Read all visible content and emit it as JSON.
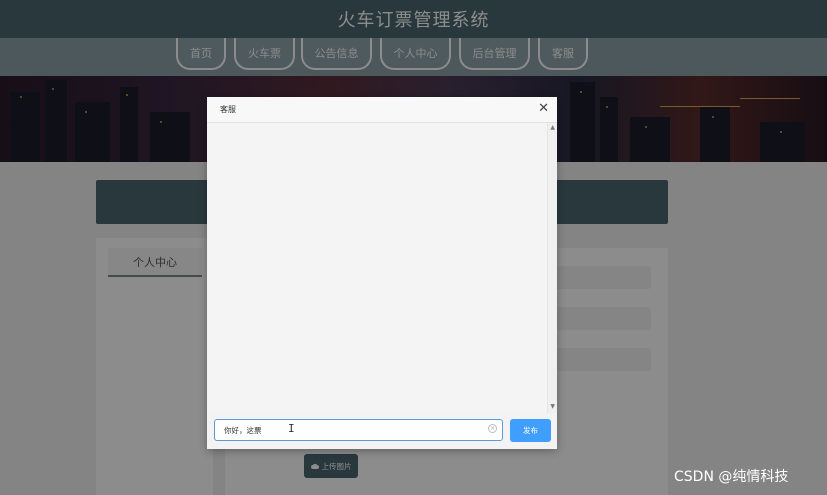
{
  "header": {
    "title": "火车订票管理系统"
  },
  "nav": {
    "tabs": [
      {
        "label": "首页"
      },
      {
        "label": "火车票"
      },
      {
        "label": "公告信息"
      },
      {
        "label": "个人中心"
      },
      {
        "label": "后台管理"
      },
      {
        "label": "客服"
      }
    ]
  },
  "sidebar": {
    "active_item": "个人中心"
  },
  "form": {
    "upload_label": "上传图片",
    "upload_icon": "cloud-upload-icon"
  },
  "dialog": {
    "title": "客服",
    "close_icon": "close-icon",
    "message_input_value": "你好，这票",
    "send_label": "发布"
  },
  "watermark": "CSDN @纯情科技",
  "colors": {
    "header": "#4a6670",
    "accent": "#409eff"
  }
}
